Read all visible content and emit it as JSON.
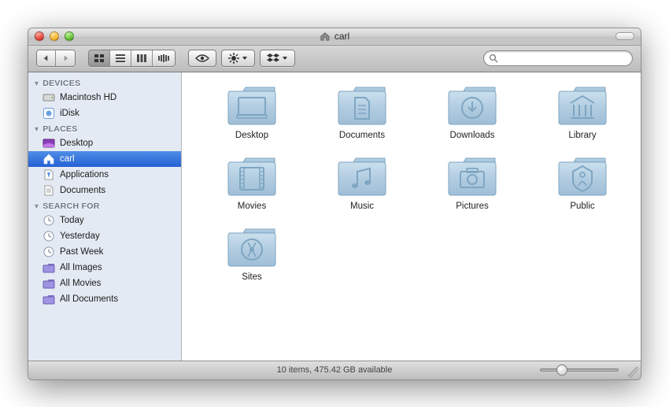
{
  "window": {
    "title": "carl"
  },
  "sidebar": {
    "sections": [
      {
        "label": "DEVICES",
        "items": [
          {
            "label": "Macintosh HD"
          },
          {
            "label": "iDisk"
          }
        ]
      },
      {
        "label": "PLACES",
        "items": [
          {
            "label": "Desktop"
          },
          {
            "label": "carl"
          },
          {
            "label": "Applications"
          },
          {
            "label": "Documents"
          }
        ]
      },
      {
        "label": "SEARCH FOR",
        "items": [
          {
            "label": "Today"
          },
          {
            "label": "Yesterday"
          },
          {
            "label": "Past Week"
          },
          {
            "label": "All Images"
          },
          {
            "label": "All Movies"
          },
          {
            "label": "All Documents"
          }
        ]
      }
    ]
  },
  "folders": [
    {
      "label": "Desktop"
    },
    {
      "label": "Documents"
    },
    {
      "label": "Downloads"
    },
    {
      "label": "Library"
    },
    {
      "label": "Movies"
    },
    {
      "label": "Music"
    },
    {
      "label": "Pictures"
    },
    {
      "label": "Public"
    },
    {
      "label": "Sites"
    }
  ],
  "status": {
    "text": "10 items, 475.42 GB available"
  },
  "search": {
    "placeholder": ""
  }
}
